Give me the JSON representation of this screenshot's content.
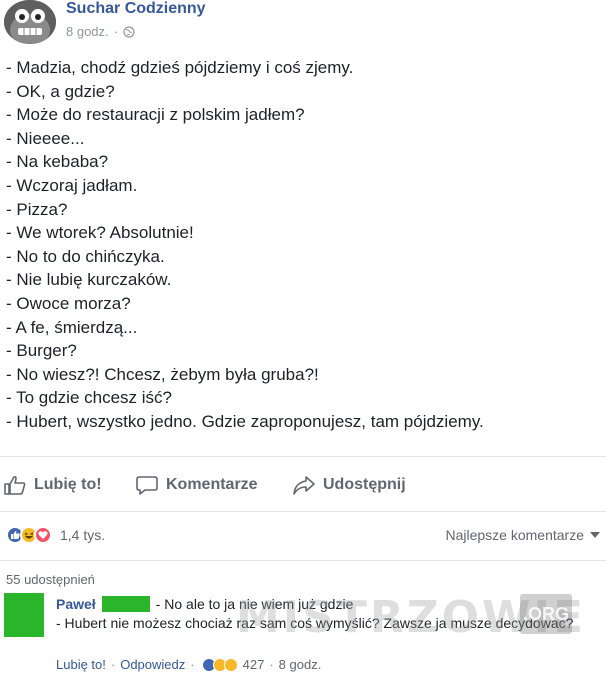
{
  "post": {
    "page_name": "Suchar Codzienny",
    "time": "8 godz.",
    "separator": "·",
    "lines": [
      "- Madzia, chodź gdzieś pójdziemy i coś zjemy.",
      "- OK, a gdzie?",
      "- Może do restauracji z polskim jadłem?",
      "- Nieeee...",
      "- Na kebaba?",
      "- Wczoraj jadłam.",
      "- Pizza?",
      "- We wtorek? Absolutnie!",
      "- No to do chińczyka.",
      "- Nie lubię kurczaków.",
      "- Owoce morza?",
      "- A fe, śmierdzą...",
      "- Burger?",
      "- No wiesz?! Chcesz, żebym była gruba?!",
      "- To gdzie chcesz iść?",
      "- Hubert, wszystko jedno. Gdzie zaproponujesz, tam pójdziemy."
    ]
  },
  "actions": {
    "like": "Lubię to!",
    "comment": "Komentarze",
    "share": "Udostępnij"
  },
  "reactions": {
    "count": "1,4 tys.",
    "sort": "Najlepsze komentarze",
    "colors": {
      "like": "#4267b2",
      "haha": "#f7b928",
      "love": "#f25268"
    }
  },
  "shares": "55 udostępnień",
  "comment": {
    "author": "Paweł",
    "line1": "- No ale to ja nie wiem już gdzie",
    "line2": "- Hubert nie możesz chociaż raz sam coś wymyślić? Zawsze ja musze decydować?",
    "like": "Lubię to!",
    "reply": "Odpowiedz",
    "reaction_count": "427",
    "time": "8 godz.",
    "separator": "·"
  },
  "watermark": {
    "text": "MISTRZOWIE",
    "badge": ".ORG"
  }
}
